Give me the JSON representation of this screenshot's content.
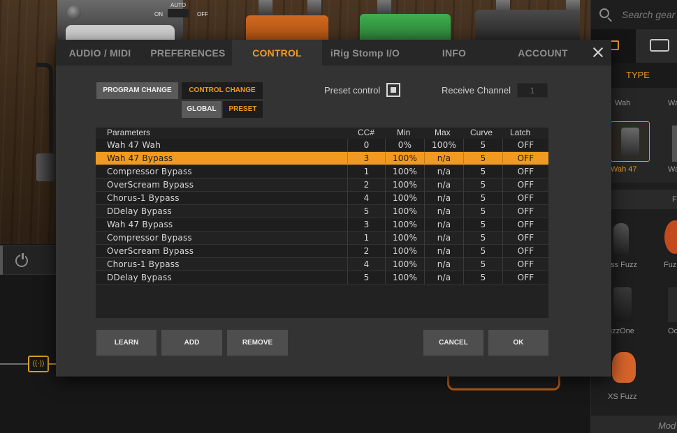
{
  "background": {
    "pedal_switch": {
      "auto": "AUTO",
      "on": "ON",
      "off": "OFF"
    },
    "search_placeholder": "Search gear",
    "type_label": "TYPE",
    "browser_labels": [
      "Wah",
      "Wa",
      "Wah 47",
      "Wa",
      "F",
      "ass Fuzz",
      "Fuz",
      "uzzOne",
      "Oc",
      "XS Fuzz"
    ],
    "bottom_label": "Mod"
  },
  "dialog": {
    "tabs": [
      {
        "label": "AUDIO / MIDI"
      },
      {
        "label": "PREFERENCES"
      },
      {
        "label": "CONTROL"
      },
      {
        "label": "iRig Stomp I/O"
      },
      {
        "label": "INFO"
      },
      {
        "label": "ACCOUNT"
      }
    ],
    "active_tab": "CONTROL",
    "mode": {
      "program_change": "PROGRAM CHANGE",
      "control_change": "CONTROL CHANGE",
      "global": "GLOBAL",
      "preset": "PRESET"
    },
    "preset_control": {
      "label": "Preset control",
      "checked": true
    },
    "receive_channel": {
      "label": "Receive Channel",
      "value": "1"
    },
    "table": {
      "headers": {
        "parameters": "Parameters",
        "cc": "CC#",
        "min": "Min",
        "max": "Max",
        "curve": "Curve",
        "latch": "Latch"
      },
      "rows": [
        {
          "name": "Wah 47 Wah",
          "cc": "0",
          "min": "0%",
          "max": "100%",
          "curve": "5",
          "latch": "OFF",
          "selected": false
        },
        {
          "name": "Wah 47 Bypass",
          "cc": "3",
          "min": "100%",
          "max": "n/a",
          "curve": "5",
          "latch": "OFF",
          "selected": true
        },
        {
          "name": "Compressor Bypass",
          "cc": "1",
          "min": "100%",
          "max": "n/a",
          "curve": "5",
          "latch": "OFF",
          "selected": false
        },
        {
          "name": "OverScream Bypass",
          "cc": "2",
          "min": "100%",
          "max": "n/a",
          "curve": "5",
          "latch": "OFF",
          "selected": false
        },
        {
          "name": "Chorus-1 Bypass",
          "cc": "4",
          "min": "100%",
          "max": "n/a",
          "curve": "5",
          "latch": "OFF",
          "selected": false
        },
        {
          "name": "DDelay Bypass",
          "cc": "5",
          "min": "100%",
          "max": "n/a",
          "curve": "5",
          "latch": "OFF",
          "selected": false
        },
        {
          "name": "Wah 47 Bypass",
          "cc": "3",
          "min": "100%",
          "max": "n/a",
          "curve": "5",
          "latch": "OFF",
          "selected": false
        },
        {
          "name": "Compressor Bypass",
          "cc": "1",
          "min": "100%",
          "max": "n/a",
          "curve": "5",
          "latch": "OFF",
          "selected": false
        },
        {
          "name": "OverScream Bypass",
          "cc": "2",
          "min": "100%",
          "max": "n/a",
          "curve": "5",
          "latch": "OFF",
          "selected": false
        },
        {
          "name": "Chorus-1 Bypass",
          "cc": "4",
          "min": "100%",
          "max": "n/a",
          "curve": "5",
          "latch": "OFF",
          "selected": false
        },
        {
          "name": "DDelay Bypass",
          "cc": "5",
          "min": "100%",
          "max": "n/a",
          "curve": "5",
          "latch": "OFF",
          "selected": false
        }
      ]
    },
    "buttons": {
      "learn": "LEARN",
      "add": "ADD",
      "remove": "REMOVE",
      "cancel": "CANCEL",
      "ok": "OK"
    }
  },
  "colors": {
    "accent": "#f29a1f",
    "dialog_bg": "#333333",
    "table_bg": "#222222"
  }
}
